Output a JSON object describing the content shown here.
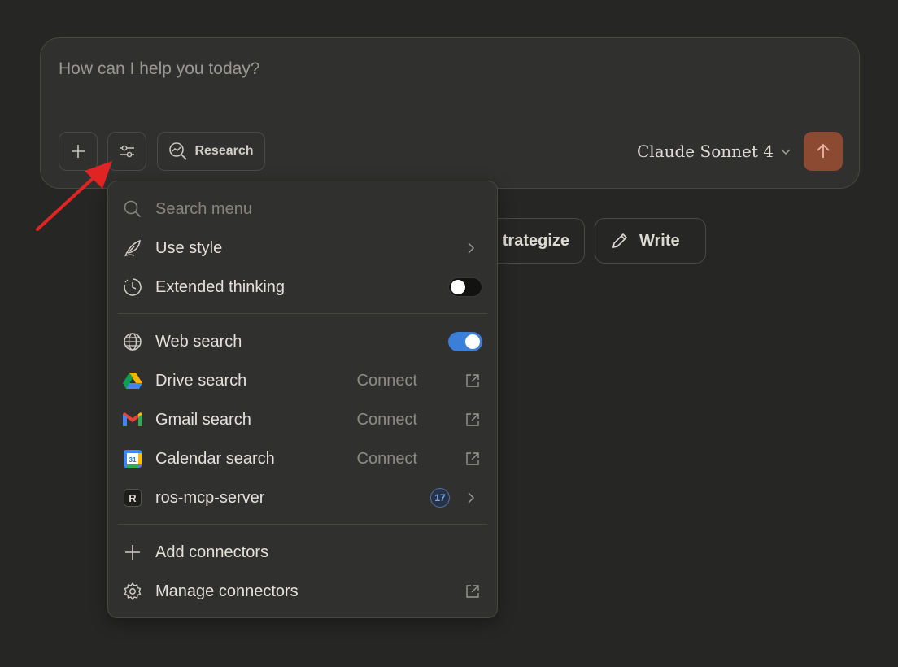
{
  "composer": {
    "placeholder": "How can I help you today?",
    "research_label": "Research",
    "model_name": "Claude Sonnet 4"
  },
  "chips": [
    {
      "label": "trategize",
      "icon": "strategize-icon"
    },
    {
      "label": "Write",
      "icon": "pencil-icon"
    }
  ],
  "menu": {
    "search_placeholder": "Search menu",
    "items": [
      {
        "label": "Use style",
        "icon": "feather-icon",
        "trailing": "chevron"
      },
      {
        "label": "Extended thinking",
        "icon": "clock-icon",
        "toggle": false
      },
      {
        "label": "Web search",
        "icon": "globe-icon",
        "toggle": true
      },
      {
        "label": "Drive search",
        "icon": "google-drive-icon",
        "action": "Connect"
      },
      {
        "label": "Gmail search",
        "icon": "gmail-icon",
        "action": "Connect"
      },
      {
        "label": "Calendar search",
        "icon": "google-calendar-icon",
        "action": "Connect",
        "icon_text": "31"
      },
      {
        "label": "ros-mcp-server",
        "icon": "r-server-icon",
        "icon_text": "R",
        "count": "17",
        "trailing": "chevron"
      },
      {
        "label": "Add connectors",
        "icon": "plus-icon"
      },
      {
        "label": "Manage connectors",
        "icon": "gear-icon",
        "trailing": "external-link"
      }
    ]
  },
  "colors": {
    "background": "#262624",
    "panel": "#30302e",
    "send_button": "#8c4a33",
    "toggle_on": "#3b7fd9",
    "annotation_arrow": "#e02424"
  }
}
